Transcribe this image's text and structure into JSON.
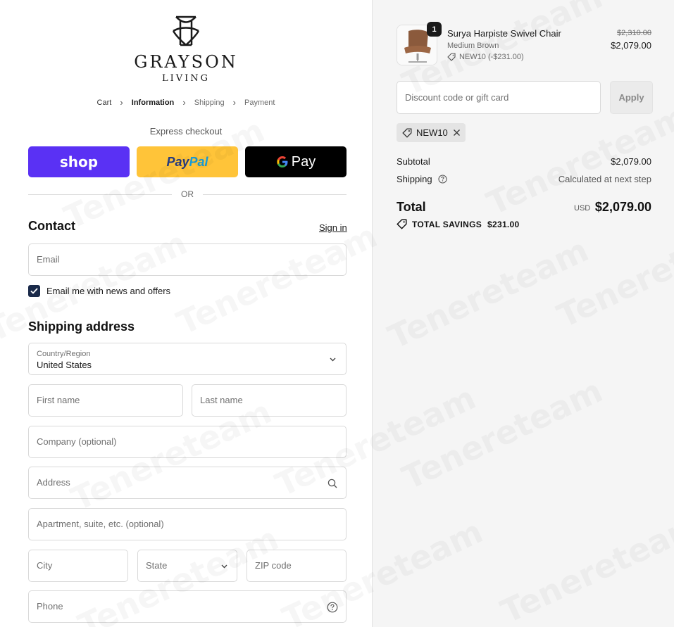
{
  "brand": {
    "name": "GRAYSON",
    "tagline": "LIVING"
  },
  "breadcrumb": [
    {
      "label": "Cart",
      "state": "link"
    },
    {
      "label": "Information",
      "state": "active"
    },
    {
      "label": "Shipping",
      "state": "muted"
    },
    {
      "label": "Payment",
      "state": "muted"
    }
  ],
  "express": {
    "title": "Express checkout",
    "shop_label": "shop",
    "paypal_label_1": "Pay",
    "paypal_label_2": "Pal",
    "gpay_g": "G",
    "gpay_label": "Pay",
    "or_label": "OR"
  },
  "contact": {
    "title": "Contact",
    "signin_label": "Sign in",
    "email_placeholder": "Email",
    "newsletter_label": "Email me with news and offers",
    "newsletter_checked": true
  },
  "shipping": {
    "title": "Shipping address",
    "country_label": "Country/Region",
    "country_value": "United States",
    "first_name_placeholder": "First name",
    "last_name_placeholder": "Last name",
    "company_placeholder": "Company (optional)",
    "address_placeholder": "Address",
    "apartment_placeholder": "Apartment, suite, etc. (optional)",
    "city_placeholder": "City",
    "state_placeholder": "State",
    "zip_placeholder": "ZIP code",
    "phone_placeholder": "Phone"
  },
  "order": {
    "item": {
      "name": "Surya Harpiste Swivel Chair",
      "variant": "Medium Brown",
      "discount": "NEW10 (-$231.00)",
      "quantity": "1",
      "original_price": "$2,310.00",
      "price": "$2,079.00"
    },
    "discount_placeholder": "Discount code or gift card",
    "apply_label": "Apply",
    "applied_code": "NEW10",
    "subtotal_label": "Subtotal",
    "subtotal_value": "$2,079.00",
    "shipping_label": "Shipping",
    "shipping_value": "Calculated at next step",
    "total_label": "Total",
    "currency": "USD",
    "total_value": "$2,079.00",
    "savings_label": "TOTAL SAVINGS",
    "savings_value": "$231.00"
  },
  "watermark": "Tenereteam",
  "colors": {
    "shop": "#5a31f4",
    "paypal": "#ffc439",
    "gpay": "#000000",
    "checkbox": "#1a2a4a",
    "summary_bg": "#f5f5f5"
  }
}
